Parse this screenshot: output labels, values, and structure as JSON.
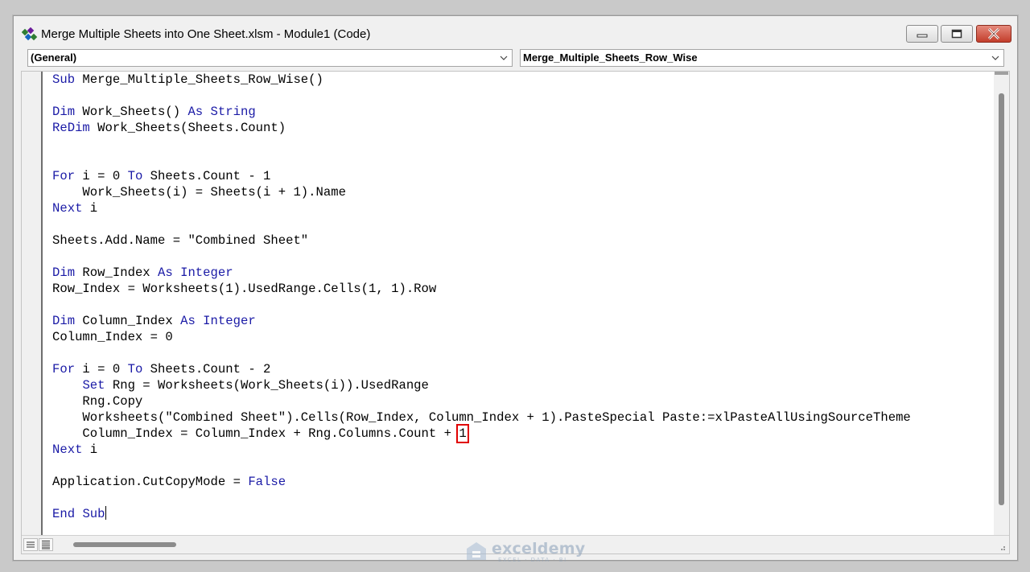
{
  "window": {
    "title": "Merge Multiple Sheets into One Sheet.xlsm - Module1 (Code)"
  },
  "toolbar": {
    "object_dropdown": "(General)",
    "procedure_dropdown": "Merge_Multiple_Sheets_Row_Wise"
  },
  "code": {
    "lines": [
      "Sub Merge_Multiple_Sheets_Row_Wise()",
      "",
      "Dim Work_Sheets() As String",
      "ReDim Work_Sheets(Sheets.Count)",
      "",
      "",
      "For i = 0 To Sheets.Count - 1",
      "    Work_Sheets(i) = Sheets(i + 1).Name",
      "Next i",
      "",
      "Sheets.Add.Name = \"Combined Sheet\"",
      "",
      "Dim Row_Index As Integer",
      "Row_Index = Worksheets(1).UsedRange.Cells(1, 1).Row",
      "",
      "Dim Column_Index As Integer",
      "Column_Index = 0",
      "",
      "For i = 0 To Sheets.Count - 2",
      "    Set Rng = Worksheets(Work_Sheets(i)).UsedRange",
      "    Rng.Copy",
      "    Worksheets(\"Combined Sheet\").Cells(Row_Index, Column_Index + 1).PasteSpecial Paste:=xlPasteAllUsingSourceTheme",
      "    Column_Index = Column_Index + Rng.Columns.Count + 1",
      "Next i",
      "",
      "Application.CutCopyMode = False",
      "",
      "End Sub"
    ],
    "highlight": {
      "line": 23,
      "text": "1"
    },
    "caret_line": 28
  },
  "watermark": {
    "name": "exceldemy",
    "tagline": "EXCEL · DATA · BI"
  },
  "colors": {
    "keyword": "#1a1aa6",
    "highlight_box": "#e00000"
  }
}
